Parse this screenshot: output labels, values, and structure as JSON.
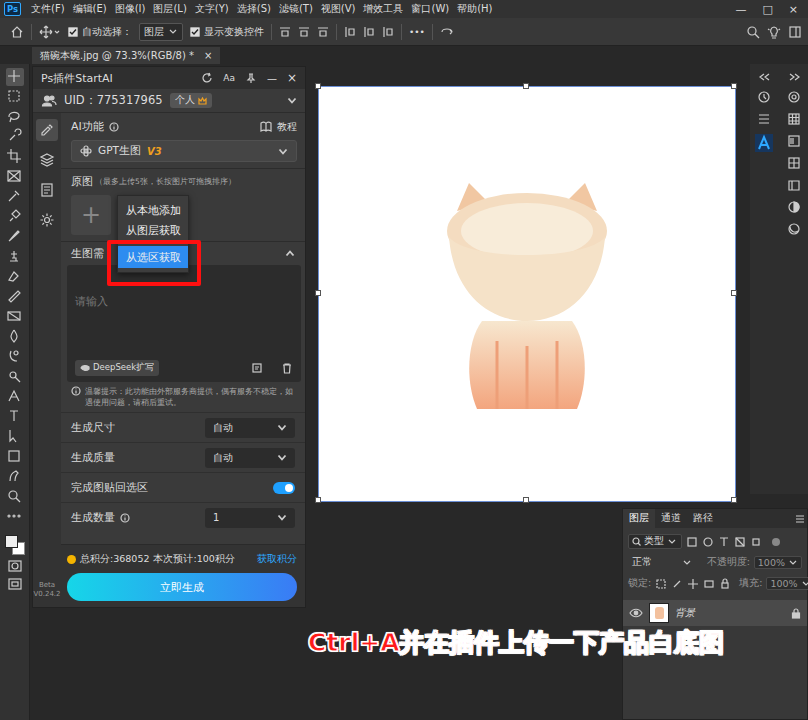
{
  "app": {
    "logo": "Ps",
    "menu": [
      "文件(F)",
      "编辑(E)",
      "图像(I)",
      "图层(L)",
      "文字(Y)",
      "选择(S)",
      "滤镜(T)",
      "视图(V)",
      "增效工具",
      "窗口(W)",
      "帮助(H)"
    ],
    "window_controls": [
      "—",
      "□",
      "×"
    ]
  },
  "options_bar": {
    "auto_select": {
      "label": "自动选择：",
      "checked": true
    },
    "target": "图层",
    "show_transform": {
      "label": "显示变换控件",
      "checked": true
    },
    "more": "•••"
  },
  "document_tab": {
    "title": "猫碗本碗.jpg @ 73.3%(RGB/8) *",
    "close": "×"
  },
  "plugin": {
    "title": "Ps插件StartAI",
    "font_button": "Aa",
    "minimize": "—",
    "close": "×",
    "uid": "UID：775317965",
    "plan": "个人",
    "nav": [
      {
        "selected": true
      },
      {
        "selected": false
      },
      {
        "selected": false
      },
      {
        "selected": false
      }
    ],
    "version": {
      "label": "Beta",
      "number": "V0.24.2"
    },
    "ai_function": {
      "label": "AI功能",
      "tutorial": "教程",
      "model": "GPT生图",
      "version": "V3"
    },
    "source": {
      "label": "原图",
      "hint": "（最多上传5张，长按图片可拖拽排序）",
      "add": "+"
    },
    "source_menu": [
      {
        "label": "从本地添加",
        "selected": false
      },
      {
        "label": "从图层获取",
        "selected": false
      },
      {
        "label": "从选区获取",
        "selected": true
      }
    ],
    "prompt": {
      "label": "生图需",
      "placeholder": "请输入",
      "expand_button": "DeepSeek扩写"
    },
    "notice": "温馨提示：此功能由外部服务商提供，偶有服务不稳定，如遇使用问题，请稍后重试。",
    "settings": [
      {
        "kind": "select",
        "label": "生成尺寸",
        "value": "自动",
        "info": false
      },
      {
        "kind": "select",
        "label": "生成质量",
        "value": "自动",
        "info": false
      },
      {
        "kind": "toggle",
        "label": "完成图贴回选区",
        "on": true,
        "info": false
      },
      {
        "kind": "select",
        "label": "生成数量",
        "value": "1",
        "info": true
      }
    ],
    "footer": {
      "points": "总积分:368052",
      "estimate": "本次预计:100积分",
      "get_points": "获取积分",
      "generate": "立即生成"
    }
  },
  "layers_panel": {
    "tabs": [
      {
        "label": "图层",
        "selected": true
      },
      {
        "label": "通道",
        "selected": false
      },
      {
        "label": "路径",
        "selected": false
      }
    ],
    "filter": "类型",
    "blend": "正常",
    "opacity_label": "不透明度:",
    "opacity": "100%",
    "lock_label": "锁定:",
    "fill_label": "填充:",
    "fill": "100%",
    "layers": [
      {
        "name": "背景",
        "visible": true,
        "locked": true,
        "selected": true
      }
    ]
  },
  "caption": "Ctrl+A并在插件上传一下产品白底图"
}
